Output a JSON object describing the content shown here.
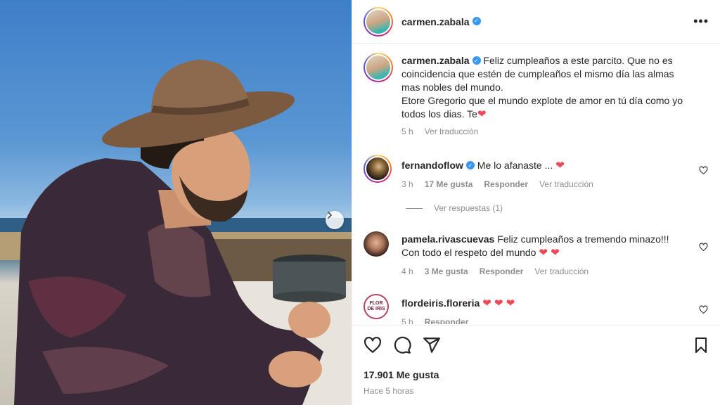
{
  "post": {
    "author": "carmen.zabala",
    "likes": "17.901 Me gusta",
    "time_ago": "Hace 5 horas"
  },
  "caption": {
    "username": "carmen.zabala",
    "text_line1": "Feliz cumpleaños a este parcito. Que no es",
    "text_line2": "coincidencia que estén de cumpleaños el mismo día las almas",
    "text_line3": "mas nobles del mundo.",
    "text_line4": "Etore Gregorio que el mundo explote de amor en tú día como yo",
    "text_line5": "todos los dias. Te",
    "heart": "❤",
    "time": "5 h",
    "translate": "Ver traducción"
  },
  "comments": [
    {
      "username": "fernandoflow",
      "text": "Me lo afanaste ...",
      "heart": "❤",
      "time": "3 h",
      "likes": "17 Me gusta",
      "reply": "Responder",
      "translate": "Ver traducción"
    },
    {
      "username": "pamela.rivascuevas",
      "text": "Feliz cumpleaños a tremendo minazo!!!",
      "text_line2": "Con todo el respeto del mundo",
      "hearts": "❤ ❤",
      "time": "4 h",
      "likes": "3 Me gusta",
      "reply": "Responder",
      "translate": "Ver traducción"
    },
    {
      "username": "flordeiris.floreria",
      "hearts": "❤ ❤ ❤",
      "avatar_text": "FLOR DE IRIS",
      "time": "5 h",
      "reply": "Responder"
    }
  ],
  "view_replies": "Ver respuestas (1)",
  "colors": {
    "verified": "#3897f0",
    "heart": "#ed4956",
    "muted": "#8e8e8e"
  },
  "icons": [
    "more-icon",
    "verified-icon",
    "heart-icon",
    "comment-icon",
    "share-icon",
    "save-icon",
    "next-arrow-icon"
  ]
}
